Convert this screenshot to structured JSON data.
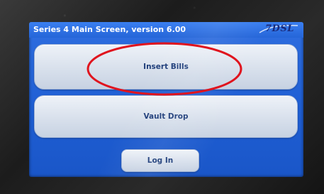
{
  "device": {
    "title": "Series 4 Main Screen, version 6.00",
    "logo_text": "7DSL",
    "accent_color": "#2565d8",
    "annotation_color": "#e0141e"
  },
  "buttons": {
    "insert_bills": "Insert Bills",
    "vault_drop": "Vault Drop",
    "log_in": "Log In"
  },
  "annotation": {
    "shape": "ellipse",
    "target": "insert-bills-button"
  }
}
